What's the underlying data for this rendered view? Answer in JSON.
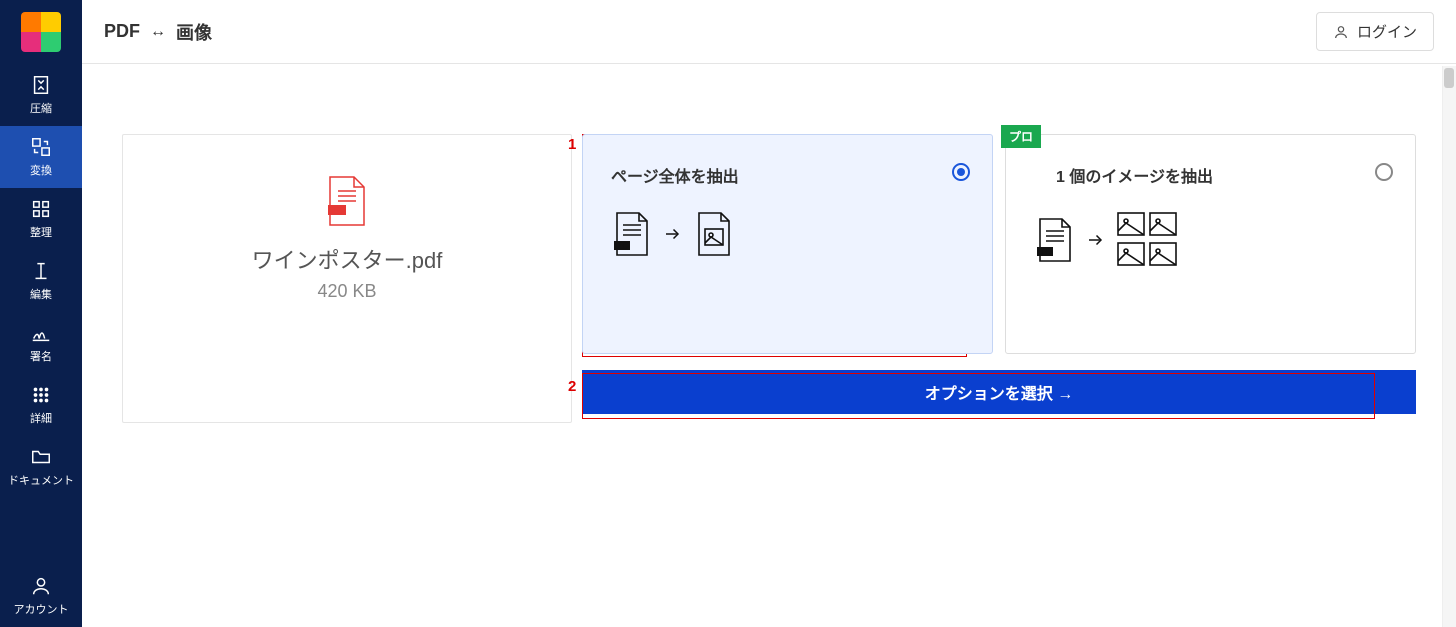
{
  "header": {
    "title_left": "PDF",
    "title_right": "画像",
    "login_label": "ログイン"
  },
  "sidebar": {
    "items": [
      {
        "label": "圧縮"
      },
      {
        "label": "変換"
      },
      {
        "label": "整理"
      },
      {
        "label": "編集"
      },
      {
        "label": "署名"
      },
      {
        "label": "詳細"
      },
      {
        "label": "ドキュメント"
      }
    ],
    "account_label": "アカウント"
  },
  "file": {
    "name": "ワインポスター.pdf",
    "size": "420 KB"
  },
  "options": {
    "opt1_label": "ページ全体を抽出",
    "opt2_label": "1 個のイメージを抽出",
    "pro_badge": "プロ",
    "action_label": "オプションを選択 →"
  },
  "annotations": {
    "n1": "1",
    "n2": "2"
  }
}
